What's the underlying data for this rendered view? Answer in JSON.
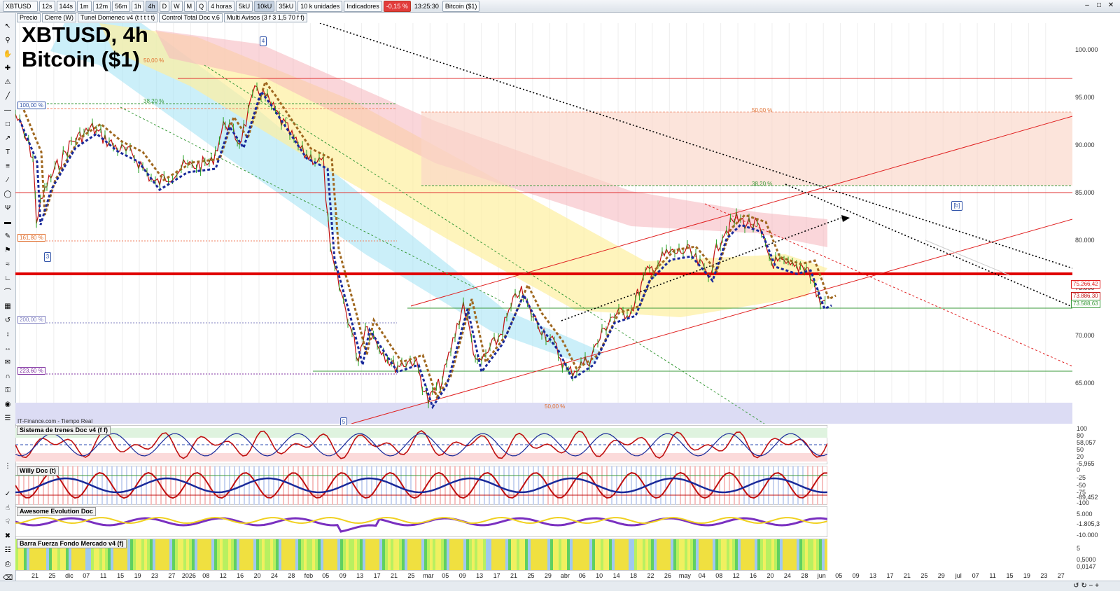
{
  "toolbar": {
    "symbol": "XBTUSD",
    "timeframes": [
      "12s",
      "144s",
      "1m",
      "12m",
      "56m",
      "1h",
      "4h",
      "D",
      "W",
      "M",
      "Q"
    ],
    "active_timeframe": "4h",
    "period": "4 horas",
    "sizes": [
      "5kU",
      "10kU",
      "35kU"
    ],
    "active_size": "10kU",
    "units": "10 k unidades",
    "indicators": "Indicadores",
    "change": "-0,15 %",
    "time": "13:25:30",
    "instrument": "Bitcoin ($1)"
  },
  "legend": {
    "price": "Precio",
    "close": "Cierre (W)",
    "tunel": "Tunel Domenec v4 (t t t t t)",
    "control": "Control Total Doc v.6",
    "avisos": "Multi Avisos (3 f 3 1,5 70 f f)"
  },
  "chart_title": {
    "line1": "XBTUSD, 4h",
    "line2": "Bitcoin ($1)"
  },
  "source": "IT-Finance.com - Tiempo Real",
  "panels": {
    "trenes": "Sistema de trenes Doc v4 (f f)",
    "willy": "Willy Doc (t)",
    "awesome": "Awesome Evolution Doc",
    "barra": "Barra Fuerza Fondo Mercado v4 (f)"
  },
  "price_axis": [
    "100.000",
    "95.000",
    "90.000",
    "85.000",
    "80.000",
    "75.000",
    "70.000",
    "65.000"
  ],
  "price_tags": [
    "75.266,42",
    "73.886,30",
    "73.588,63"
  ],
  "fib_labels": {
    "p100": "100,00 %",
    "p161": "161,80 %",
    "p200": "200,00 %",
    "p223": "223,60 %",
    "p38a": "38,20 %",
    "p50a": "50,00 %",
    "p50b": "50,00 %",
    "p38b": "38,20 %",
    "p50c": "50,00 %"
  },
  "waves": {
    "w3": "3",
    "w4": "4",
    "w5": "5",
    "wb": "[b]"
  },
  "sub_axis": {
    "trenes": [
      "100",
      "80",
      "58,057",
      "50",
      "20",
      "-5,965"
    ],
    "willy": [
      "0",
      "-25",
      "-50",
      "-75",
      "-89,452",
      "-100"
    ],
    "awesome": [
      "5.000",
      "-1.805,3",
      "-10.000"
    ],
    "barra": [
      "5",
      "0,5000",
      "0,0147"
    ]
  },
  "dates": [
    "21",
    "25",
    "dic",
    "07",
    "11",
    "15",
    "19",
    "23",
    "27",
    "2026",
    "08",
    "12",
    "16",
    "20",
    "24",
    "28",
    "feb",
    "05",
    "09",
    "13",
    "17",
    "21",
    "25",
    "mar",
    "05",
    "09",
    "13",
    "17",
    "21",
    "25",
    "29",
    "abr",
    "06",
    "10",
    "14",
    "18",
    "22",
    "26",
    "may",
    "04",
    "08",
    "12",
    "16",
    "20",
    "24",
    "28",
    "jun",
    "05",
    "09",
    "13",
    "17",
    "21",
    "25",
    "29",
    "jul",
    "07",
    "11",
    "15",
    "19",
    "23",
    "27"
  ]
}
